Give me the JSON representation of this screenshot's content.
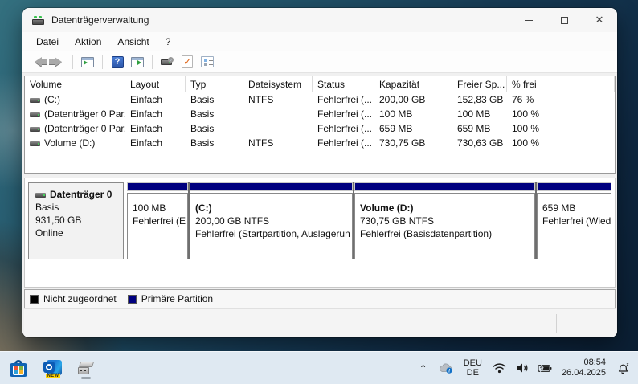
{
  "window": {
    "title": "Datenträgerverwaltung",
    "menus": {
      "datei": "Datei",
      "aktion": "Aktion",
      "ansicht": "Ansicht",
      "hilfe": "?"
    },
    "toolbar_icons": [
      "back",
      "forward",
      "show-console-tree",
      "help",
      "show-action-pane",
      "rescan-disks",
      "check",
      "properties"
    ],
    "caption_icons": [
      "minimize",
      "maximize",
      "close"
    ]
  },
  "volume_table": {
    "columns": [
      "Volume",
      "Layout",
      "Typ",
      "Dateisystem",
      "Status",
      "Kapazität",
      "Freier Sp...",
      "% frei"
    ],
    "rows": [
      {
        "volume": "(C:)",
        "layout": "Einfach",
        "typ": "Basis",
        "dateisystem": "NTFS",
        "status": "Fehlerfrei (...",
        "kapazitaet": "200,00 GB",
        "freier_sp": "152,83 GB",
        "frei": "76 %"
      },
      {
        "volume": "(Datenträger 0 Par...",
        "layout": "Einfach",
        "typ": "Basis",
        "dateisystem": "",
        "status": "Fehlerfrei (...",
        "kapazitaet": "100 MB",
        "freier_sp": "100 MB",
        "frei": "100 %"
      },
      {
        "volume": "(Datenträger 0 Par...",
        "layout": "Einfach",
        "typ": "Basis",
        "dateisystem": "",
        "status": "Fehlerfrei (...",
        "kapazitaet": "659 MB",
        "freier_sp": "659 MB",
        "frei": "100 %"
      },
      {
        "volume": "Volume (D:)",
        "layout": "Einfach",
        "typ": "Basis",
        "dateisystem": "NTFS",
        "status": "Fehlerfrei (...",
        "kapazitaet": "730,75 GB",
        "freier_sp": "730,63 GB",
        "frei": "100 %"
      }
    ]
  },
  "disk_view": {
    "disk": {
      "name": "Datenträger 0",
      "typ": "Basis",
      "size": "931,50 GB",
      "status": "Online"
    },
    "partitions": [
      {
        "title": "",
        "size_line": "100 MB",
        "status_line": "Fehlerfrei (E"
      },
      {
        "title": "(C:)",
        "size_line": "200,00 GB NTFS",
        "status_line": "Fehlerfrei (Startpartition, Auslagerun"
      },
      {
        "title": "Volume  (D:)",
        "size_line": "730,75 GB NTFS",
        "status_line": "Fehlerfrei (Basisdatenpartition)"
      },
      {
        "title": "",
        "size_line": "659 MB",
        "status_line": "Fehlerfrei (Wiederh"
      }
    ],
    "partition_color": "#00007f"
  },
  "legend": {
    "items": [
      {
        "label": "Nicht zugeordnet",
        "color": "#000000"
      },
      {
        "label": "Primäre Partition",
        "color": "#00007f"
      }
    ]
  },
  "taskbar": {
    "apps": [
      "microsoft-store",
      "outlook-new",
      "disk-management"
    ],
    "outlook_badge": "NEW",
    "tray": {
      "icons": [
        "hidden-icons-chevron",
        "onedrive-cloud",
        "wifi",
        "volume",
        "battery-charging",
        "notification-bell-dnd"
      ],
      "language_line1": "DEU",
      "language_line2": "DE",
      "time": "08:54",
      "date": "26.04.2025"
    }
  },
  "colors": {
    "primary_partition": "#00007f",
    "unallocated": "#000000",
    "taskbar_bg": "#dfe9f2",
    "desktop_teal": "#23566c",
    "window_bg": "#f0f0f0"
  }
}
